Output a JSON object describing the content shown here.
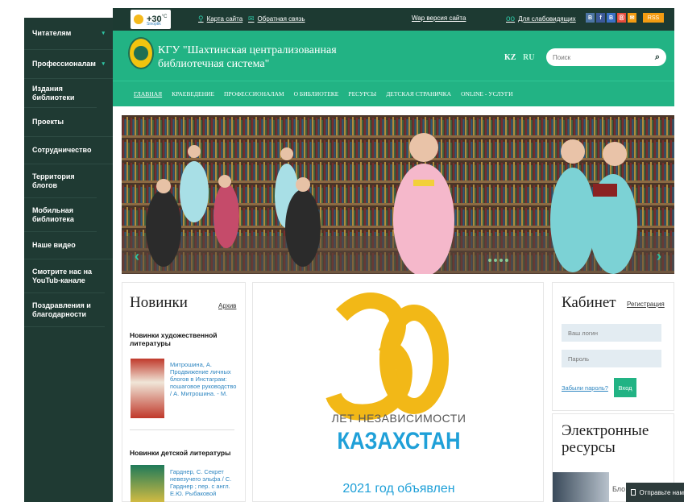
{
  "sidebar": {
    "items": [
      {
        "label": "Читателям",
        "chevron": "▾"
      },
      {
        "label": "Профессионалам",
        "chevron": "▾"
      },
      {
        "label": "Издания библиотеки",
        "chevron": ""
      },
      {
        "label": "Проекты",
        "chevron": ""
      },
      {
        "label": "Сотрудничество",
        "chevron": ""
      },
      {
        "label": "Территория блогов",
        "chevron": ""
      },
      {
        "label": "Мобильная библиотека",
        "chevron": ""
      },
      {
        "label": "Наше видео",
        "chevron": ""
      },
      {
        "label": "Смотрите нас на YouTub-канале",
        "chevron": ""
      },
      {
        "label": "Поздравления и благодарности",
        "chevron": ""
      }
    ]
  },
  "topbar": {
    "weather_temp": "+30",
    "weather_unit": "°C",
    "weather_brand": "Sinoptik",
    "site_map": "Карта сайта",
    "feedback": "Обратная связь",
    "wap": "Wap версия сайта",
    "low_vision": "Для слабовидящих",
    "social": [
      "В",
      "f",
      "В",
      "Ⓑ",
      "✉"
    ],
    "rss": "RSS"
  },
  "header": {
    "title": "КГУ \"Шахтинская централизованная библиотечная система\"",
    "lang_kz": "KZ",
    "lang_ru": "RU",
    "search_placeholder": "Поиск"
  },
  "nav": {
    "items": [
      "ГЛАВНАЯ",
      "КРАЕВЕДЕНИЕ",
      "ПРОФЕССИОНАЛАМ",
      "О БИБЛИОТЕКЕ",
      "РЕСУРСЫ",
      "ДЕТСКАЯ СТРАНИЧКА",
      "ONLINE - УСЛУГИ"
    ]
  },
  "news": {
    "title": "Новинки",
    "archive": "Архив",
    "cat1": "Новинки художественной литературы",
    "book1": "Митрошина, А. Продвижение личных блогов в Инстаграм: пошаговое руководство / А. Митрошина. - М.",
    "cat2": "Новинки детской литературы",
    "book2": "Гарднер, С. Секрет невезучего эльфа / С. Гарднер ; пер. с англ. Е.Ю. Рыбаковой"
  },
  "center": {
    "number": "30",
    "line1": "ЛЕТ НЕЗАВИСИМОСТИ",
    "line2": "КАЗАХСТАН",
    "line3": "2021 год объявлен"
  },
  "cabinet": {
    "title": "Кабинет",
    "register": "Регистрация",
    "login_placeholder": "Ваш логин",
    "password_placeholder": "Пароль",
    "forgot": "Забыли пароль?",
    "enter": "Вход"
  },
  "eres": {
    "title": "Электронные ресурсы",
    "snippet": "Бло рук"
  },
  "chat": {
    "label": "Отправьте нам"
  },
  "colors": {
    "green": "#22b384",
    "dark": "#1d3a32",
    "accent_yellow": "#f2b817",
    "accent_blue": "#1fa0d8"
  }
}
